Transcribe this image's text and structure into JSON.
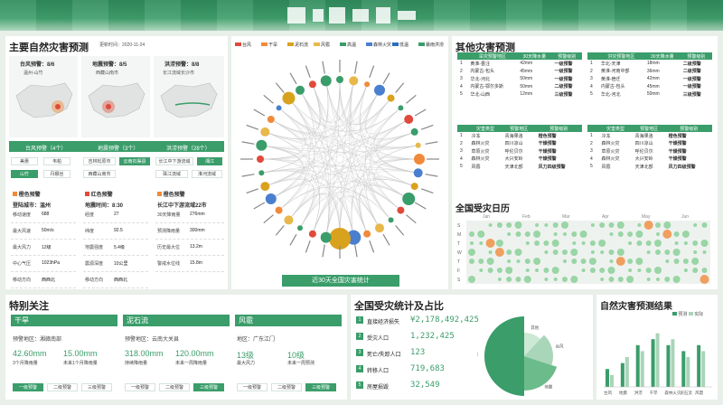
{
  "header": {
    "colors": {
      "primary": "#3a9d6a",
      "light": "#a9d5b8"
    }
  },
  "left": {
    "title": "主要自然灾害预测",
    "update": "更新时间：2020-11-24",
    "cards": [
      {
        "head": "台风预警：8/6",
        "place": "温州-山竹"
      },
      {
        "head": "地震预警：8/5",
        "place": "西藏山南市"
      },
      {
        "head": "洪涝预警：8/8",
        "place": "长江流域长沙市"
      }
    ],
    "tabs": [
      "台风预警（4个）",
      "地震预警（3个）",
      "洪涝预警（28个）"
    ],
    "tags": [
      [
        "美惠",
        "韦帕",
        "山竹",
        "丹娜丝"
      ],
      [
        "吉林松原市",
        "云南石渠县",
        "西藏山南市"
      ],
      [
        "长江中下游流域",
        "湘江",
        "珠江流域",
        "淮河流域"
      ]
    ],
    "levels": [
      "橙色预警",
      "红色预警",
      "橙色预警"
    ],
    "typhoon": {
      "title": "登陆城市：温州",
      "rows": [
        [
          "移动速度",
          "688"
        ],
        [
          "最大风速",
          "50m/s"
        ],
        [
          "最大风力",
          "12级"
        ],
        [
          "中心气压",
          "1023hPa"
        ],
        [
          "移动方向",
          "西西北"
        ]
      ]
    },
    "quake": {
      "title": "地震时间：8:30",
      "rows": [
        [
          "经度",
          "27"
        ],
        [
          "纬度",
          "92.5"
        ],
        [
          "地震强度",
          "5.4级"
        ],
        [
          "震源深度",
          "10公里"
        ],
        [
          "移动方向",
          "西西北"
        ]
      ]
    },
    "flood": {
      "title": "长江中下游流域22市",
      "rows": [
        [
          "30天降雨量",
          "276mm"
        ],
        [
          "预测降雨量",
          "300mm"
        ],
        [
          "历史最大位",
          "13.2m"
        ],
        [
          "警戒水位线",
          "15.8m"
        ]
      ]
    }
  },
  "center": {
    "legend": [
      "台风",
      "干旱",
      "泥石流",
      "风雹",
      "高温",
      "森林火灾",
      "低温",
      "暴雨洪涝"
    ],
    "legend_colors": [
      "#e04a3a",
      "#f08a3a",
      "#d9a21c",
      "#e8b84a",
      "#3a9d6a",
      "#4a7fd0",
      "#2a6fbf",
      "#3a9d6a"
    ],
    "caption": "近30天全国灾害统计"
  },
  "right": {
    "title": "其他灾害预测",
    "t1": {
      "headers": [
        "旱灾预警地区",
        "30天降水量",
        "预警级别"
      ],
      "rows": [
        [
          "1",
          "黄淮-晋汪",
          "42mm",
          "一级预警"
        ],
        [
          "2",
          "内蒙古-包头",
          "45mm",
          "一级预警"
        ],
        [
          "3",
          "华北-河北",
          "50mm",
          "一级预警"
        ],
        [
          "4",
          "内蒙古-鄂尔多斯",
          "50mm",
          "二级预警"
        ],
        [
          "5",
          "华北-山西",
          "12mm",
          "三级预警"
        ]
      ]
    },
    "t2": {
      "headers": [
        "洪灾预警地区",
        "30天降水量",
        "预警级别"
      ],
      "rows": [
        [
          "1",
          "华北-天津",
          "18mm",
          "二级预警"
        ],
        [
          "2",
          "黄淮-河南中部",
          "36mm",
          "二级预警"
        ],
        [
          "3",
          "黄淮-宿迁",
          "42mm",
          "一级预警"
        ],
        [
          "4",
          "内蒙古-包头",
          "45mm",
          "一级预警"
        ],
        [
          "5",
          "华北-河北",
          "50mm",
          "三级预警"
        ]
      ]
    },
    "t3": {
      "headers": [
        "灾害类型",
        "预警地区",
        "预警级别"
      ],
      "rows": [
        [
          "1",
          "冷冻",
          "青海果洛",
          "橙色预警"
        ],
        [
          "2",
          "森林火灾",
          "四川凉山",
          "干燥预警"
        ],
        [
          "3",
          "草原火灾",
          "呼伦贝尔",
          "干燥预警"
        ],
        [
          "4",
          "森林火灾",
          "大兴安岭",
          "干燥预警"
        ],
        [
          "5",
          "风雹",
          "天津北部",
          "风力四级预警"
        ]
      ]
    },
    "t4": {
      "headers": [
        "灾害类型",
        "预警地区",
        "预警级别"
      ],
      "rows": [
        [
          "1",
          "冷冻",
          "青海果洛",
          "橙色预警"
        ],
        [
          "2",
          "森林火灾",
          "四川凉山",
          "干燥预警"
        ],
        [
          "3",
          "草原火灾",
          "呼伦贝尔",
          "干燥预警"
        ],
        [
          "4",
          "森林火灾",
          "大兴安岭",
          "干燥预警"
        ],
        [
          "5",
          "风雹",
          "天津北部",
          "风力四级预警"
        ]
      ]
    },
    "calendar_title": "全国受灾日历",
    "weekdays": [
      "S",
      "M",
      "T",
      "W",
      "T",
      "F",
      "S"
    ],
    "months": [
      "Jan",
      "Feb",
      "Mar",
      "Apr",
      "May",
      "Jun"
    ]
  },
  "bottom": {
    "focus_title": "特别关注",
    "cards": [
      {
        "name": "干旱",
        "region": "预警地区：湘赣南部",
        "v1": "42.60mm",
        "l1": "3个月降雨量",
        "v2": "15.00mm",
        "l2": "未来1个月降雨量",
        "btns": [
          "一级预警",
          "二级预警",
          "三级预警"
        ],
        "active": 0
      },
      {
        "name": "泥石流",
        "region": "预警地区：云南大关县",
        "v1": "318.00mm",
        "l1": "持续降雨量",
        "v2": "120.00mm",
        "l2": "未来一周降雨量",
        "btns": [
          "一级预警",
          "二级预警",
          "三级预警"
        ],
        "active": 2
      },
      {
        "name": "风雹",
        "region": "地区：广东江门",
        "v1": "13级",
        "l1": "最大风力",
        "v2": "10级",
        "l2": "未来一周预测",
        "btns": [
          "一级预警",
          "二级预警",
          "三级预警"
        ],
        "active": 2
      }
    ],
    "stats_title": "全国受灾统计及占比",
    "stats": [
      [
        "1",
        "直接经济损失",
        "¥2,178,492,425"
      ],
      [
        "2",
        "受灾人口",
        "1,232,425"
      ],
      [
        "3",
        "死亡/失踪人口",
        "123"
      ],
      [
        "4",
        "转移人口",
        "719,683"
      ],
      [
        "5",
        "房屋损毁",
        "32,549"
      ]
    ],
    "pie_labels": [
      "其他",
      "台风",
      "地震",
      "洪涝"
    ],
    "result_title": "自然灾害预测结果",
    "legend": [
      "预测",
      "实际"
    ]
  },
  "chart_data": {
    "type": "bar",
    "categories": [
      "台风",
      "地震",
      "洪涝",
      "干旱",
      "森林火灾",
      "泥石流",
      "风雹"
    ],
    "series": [
      {
        "name": "预测",
        "values": [
          3,
          4,
          7,
          8,
          7,
          6,
          7
        ]
      },
      {
        "name": "实际",
        "values": [
          2,
          5,
          6,
          9,
          8,
          5,
          6
        ]
      }
    ]
  }
}
